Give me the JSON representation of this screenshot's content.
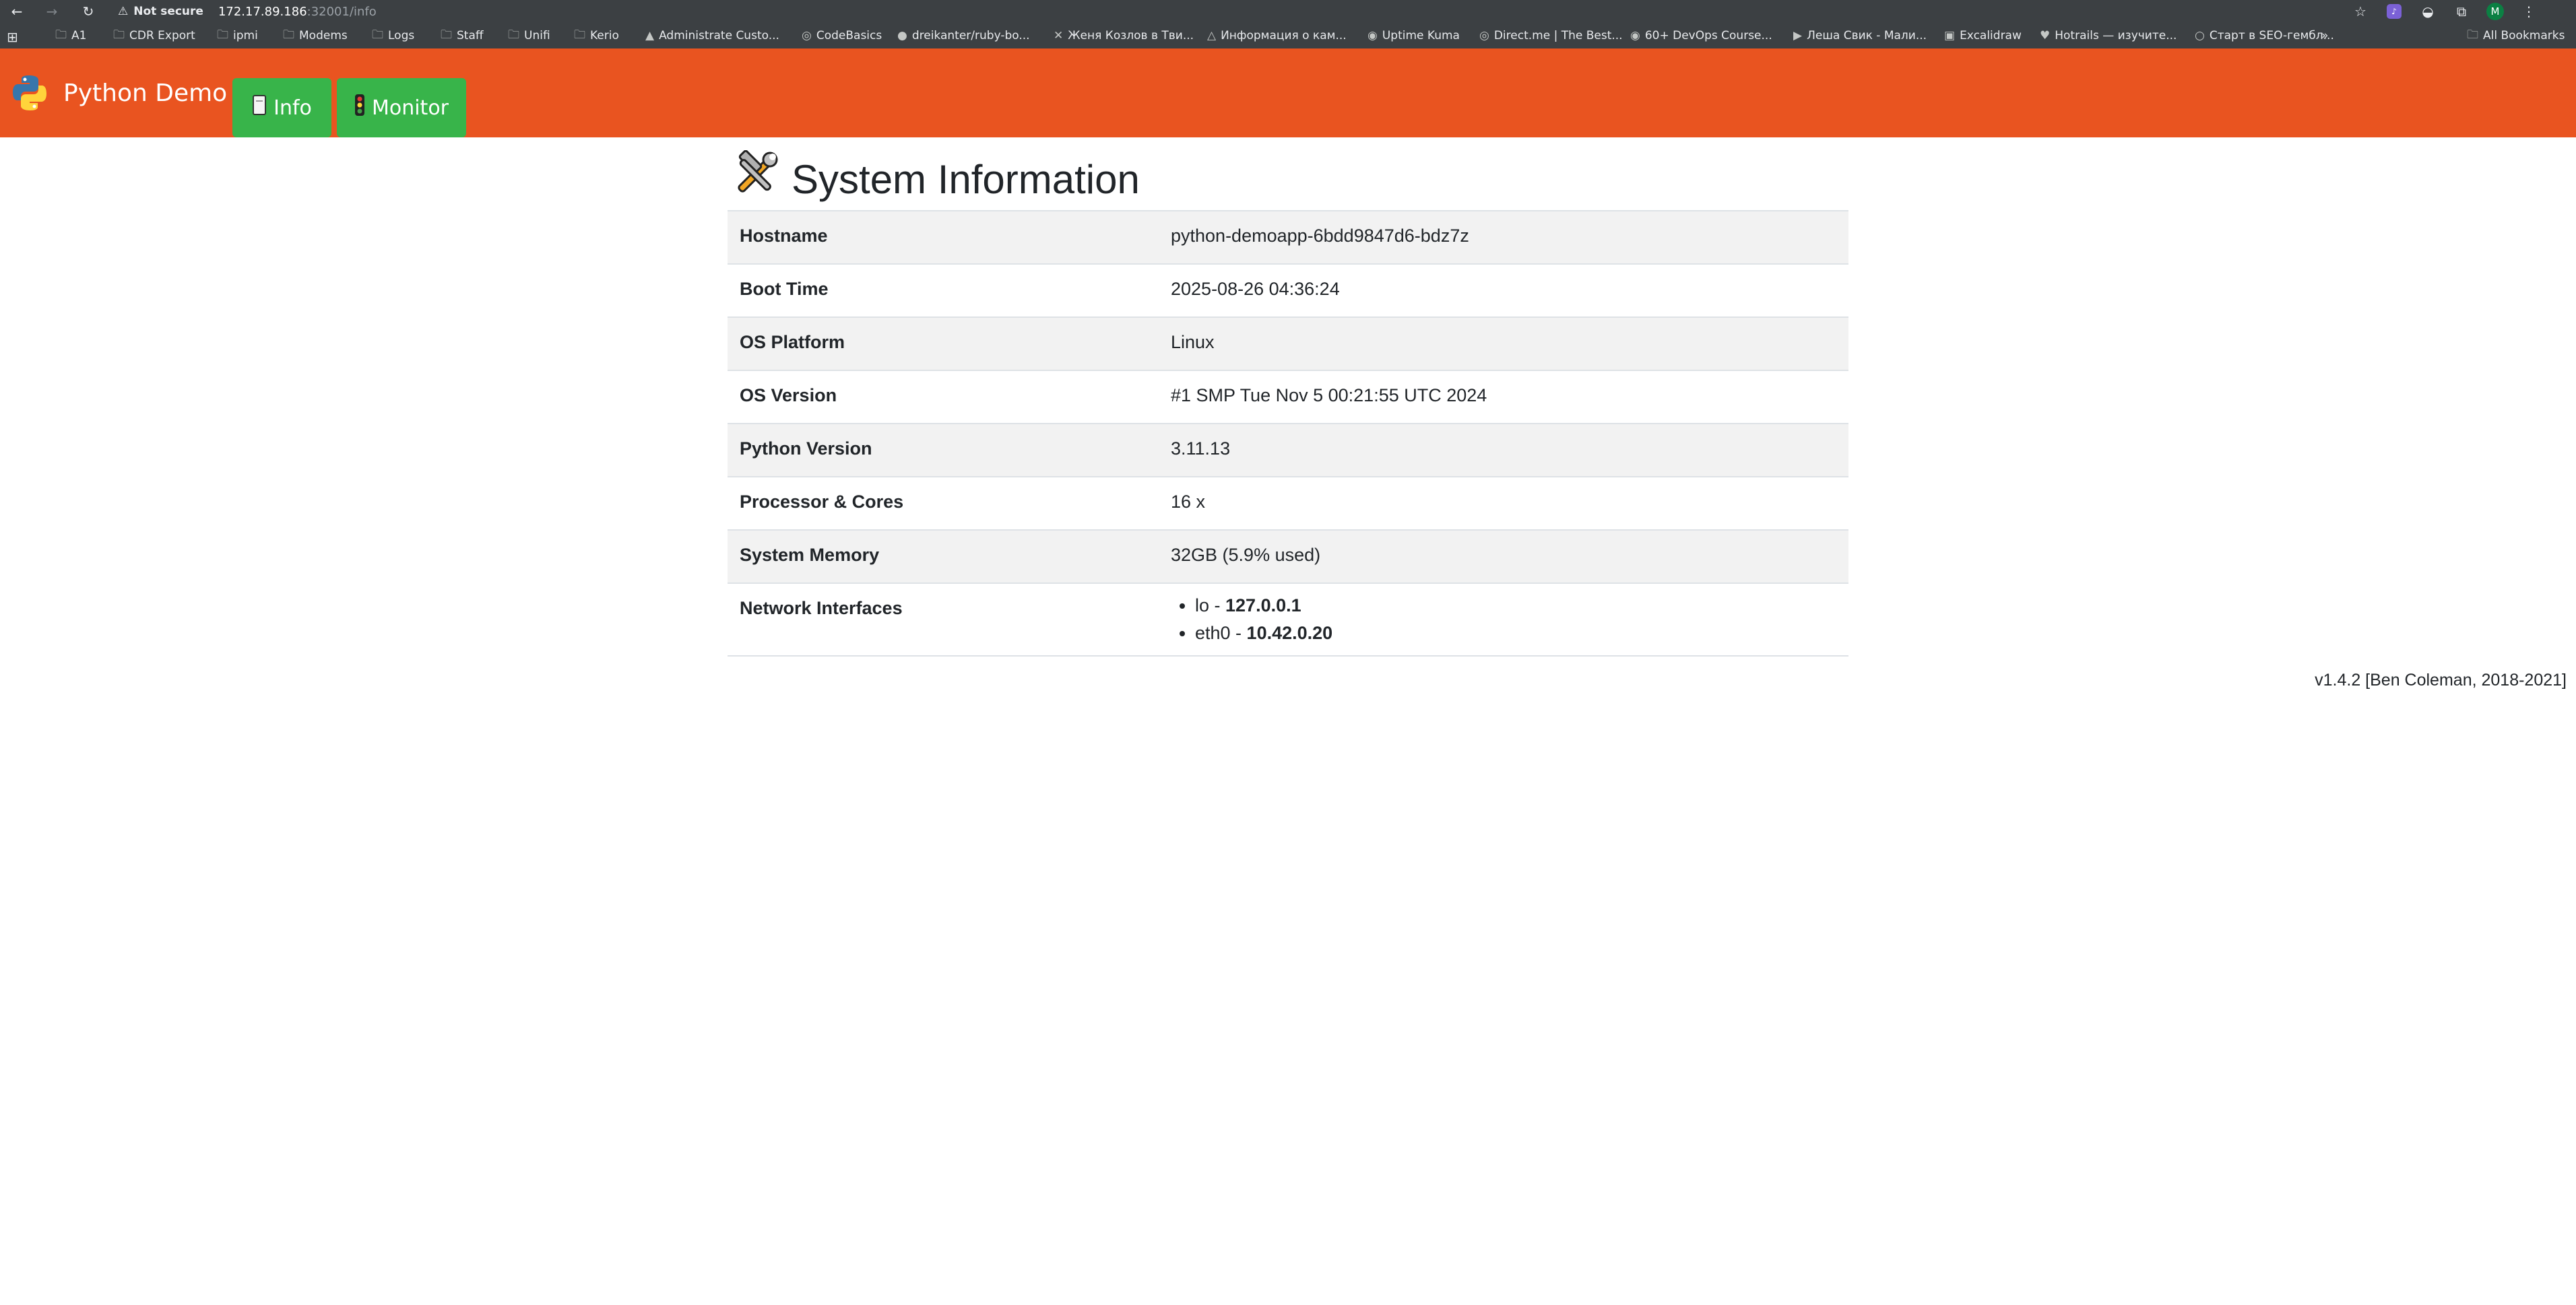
{
  "browser": {
    "security_label": "Not secure",
    "url_host": "172.17.89.186",
    "url_path": ":32001/info",
    "bookmarks": [
      "A1",
      "CDR Export",
      "ipmi",
      "Modems",
      "Logs",
      "Staff",
      "Unifi",
      "Kerio",
      "Administrate Custo...",
      "CodeBasics",
      "dreikanter/ruby-bo...",
      "Женя Козлов в Тви...",
      "Информация о кам...",
      "Uptime Kuma",
      "Direct.me | The Best...",
      "60+ DevOps Course...",
      "Леша Свик - Мали...",
      "Excalidraw",
      "Hotrails — изучите...",
      "Старт в SEO-гембл..."
    ],
    "all_bookmarks": "All Bookmarks",
    "avatar_letter": "M"
  },
  "navbar": {
    "brand": "Python Demo",
    "info_label": "Info",
    "monitor_label": "Monitor"
  },
  "page": {
    "title": "System Information",
    "rows": [
      {
        "label": "Hostname",
        "value": "python-demoapp-6bdd9847d6-bdz7z"
      },
      {
        "label": "Boot Time",
        "value": "2025-08-26 04:36:24"
      },
      {
        "label": "OS Platform",
        "value": "Linux"
      },
      {
        "label": "OS Version",
        "value": "#1 SMP Tue Nov 5 00:21:55 UTC 2024"
      },
      {
        "label": "Python Version",
        "value": "3.11.13"
      },
      {
        "label": "Processor & Cores",
        "value": "16 x"
      },
      {
        "label": "System Memory",
        "value": "32GB (5.9% used)"
      }
    ],
    "network": {
      "label": "Network Interfaces",
      "interfaces": [
        {
          "name": "lo - ",
          "ip": "127.0.0.1"
        },
        {
          "name": "eth0 - ",
          "ip": "10.42.0.20"
        }
      ]
    },
    "footer": "v1.4.2 [Ben Coleman, 2018-2021]"
  },
  "colors": {
    "navbar": "#e95420",
    "nav_button": "#38b44a",
    "stripe": "#f2f2f2"
  }
}
